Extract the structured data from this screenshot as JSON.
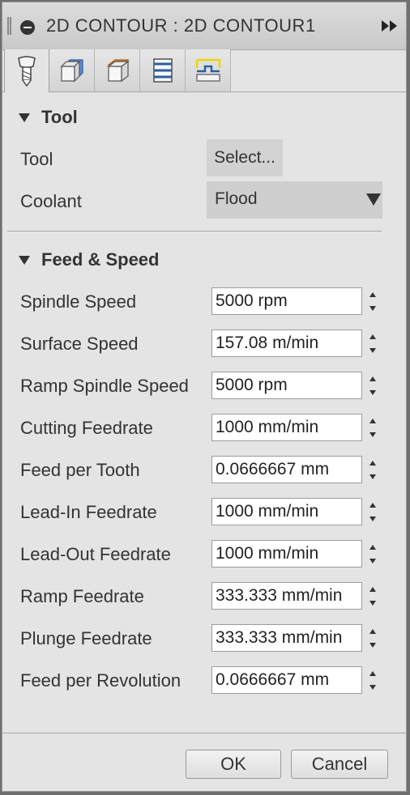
{
  "titlebar": {
    "title": "2D CONTOUR : 2D CONTOUR1",
    "collapse_icon": "minus-circle-icon",
    "expand_icon": "double-chevron-right-icon"
  },
  "tabs": [
    {
      "id": "tool",
      "icon": "endmill-tool-icon",
      "active": true
    },
    {
      "id": "geometry",
      "icon": "geometry-cube-icon",
      "active": false
    },
    {
      "id": "heights",
      "icon": "heights-box-icon",
      "active": false
    },
    {
      "id": "passes",
      "icon": "passes-layers-icon",
      "active": false
    },
    {
      "id": "linking",
      "icon": "linking-path-icon",
      "active": false
    }
  ],
  "tool_section": {
    "heading": "Tool",
    "tool_label": "Tool",
    "tool_button": "Select...",
    "coolant_label": "Coolant",
    "coolant_value": "Flood"
  },
  "feed_section": {
    "heading": "Feed & Speed",
    "rows": [
      {
        "label": "Spindle Speed",
        "value": "5000 rpm"
      },
      {
        "label": "Surface Speed",
        "value": "157.08 m/min"
      },
      {
        "label": "Ramp Spindle Speed",
        "value": "5000 rpm"
      },
      {
        "label": "Cutting Feedrate",
        "value": "1000 mm/min"
      },
      {
        "label": "Feed per Tooth",
        "value": "0.0666667 mm"
      },
      {
        "label": "Lead-In Feedrate",
        "value": "1000 mm/min"
      },
      {
        "label": "Lead-Out Feedrate",
        "value": "1000 mm/min"
      },
      {
        "label": "Ramp Feedrate",
        "value": "333.333 mm/min"
      },
      {
        "label": "Plunge Feedrate",
        "value": "333.333 mm/min"
      },
      {
        "label": "Feed per Revolution",
        "value": "0.0666667 mm"
      }
    ]
  },
  "footer": {
    "ok_label": "OK",
    "cancel_label": "Cancel"
  },
  "colors": {
    "panel_bg": "#e4e4e4",
    "yellow_accent": "#e8d800",
    "blue_accent": "#2a5f9e",
    "orange_accent": "#e08a20"
  }
}
